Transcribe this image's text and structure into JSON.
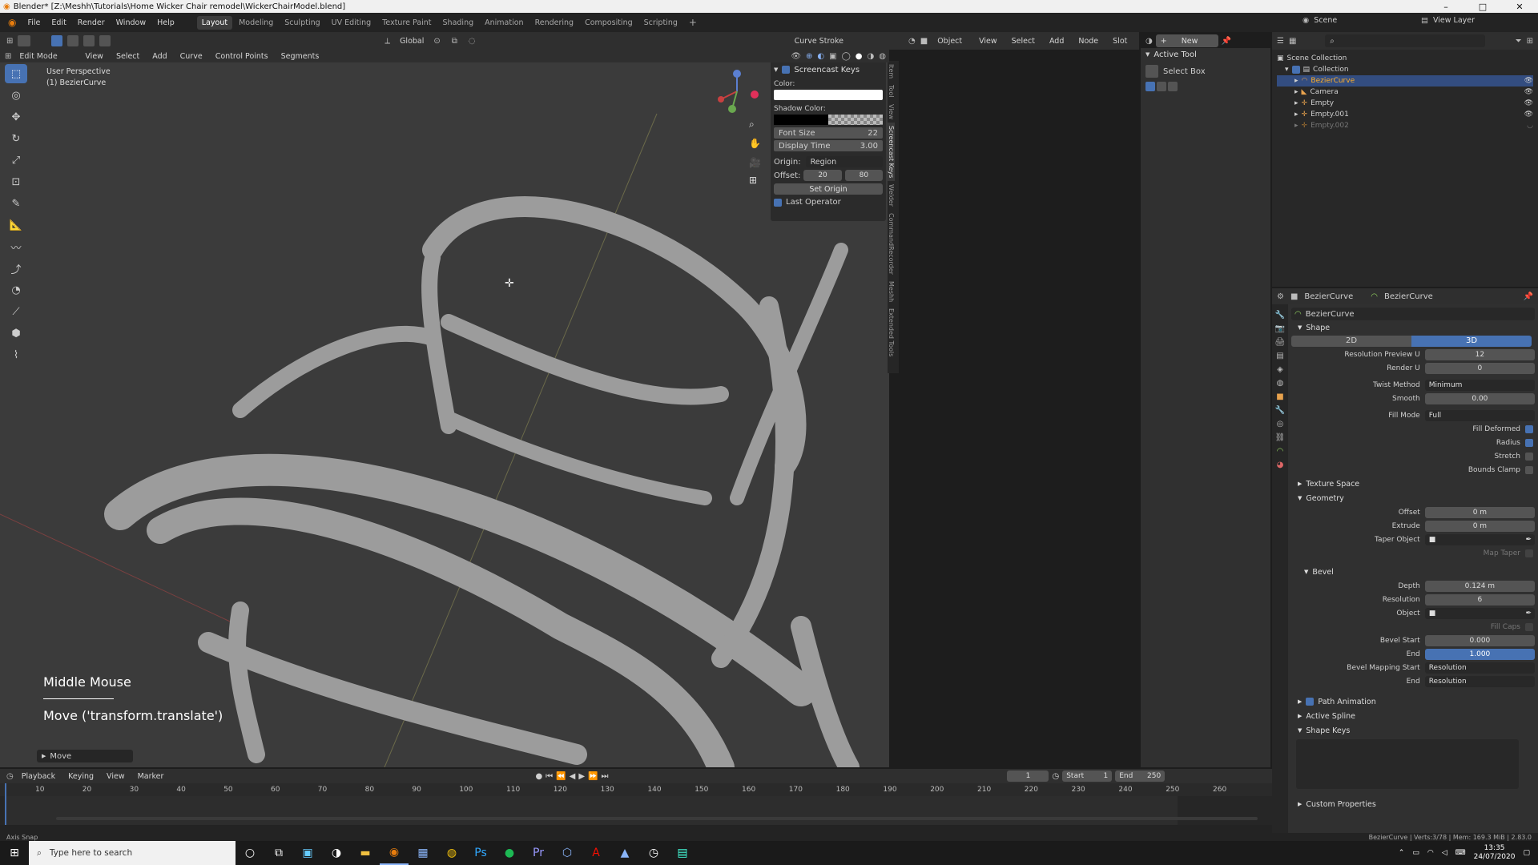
{
  "title_bar": {
    "text": "Blender* [Z:\\Meshh\\Tutorials\\Home Wicker Chair remodel\\WickerChairModel.blend]"
  },
  "menu": [
    "File",
    "Edit",
    "Render",
    "Window",
    "Help"
  ],
  "workspaces": [
    "Layout",
    "Modeling",
    "Sculpting",
    "UV Editing",
    "Texture Paint",
    "Shading",
    "Animation",
    "Rendering",
    "Compositing",
    "Scripting"
  ],
  "header": {
    "orientation": "Global",
    "curve_stroke": "Curve Stroke"
  },
  "vp_header": {
    "mode": "Edit Mode",
    "items": [
      "View",
      "Select",
      "Add",
      "Curve",
      "Control Points",
      "Segments"
    ]
  },
  "viewport": {
    "perspective": "User Perspective",
    "object": "(1) BezierCurve",
    "screencast_key": "Middle Mouse",
    "screencast_op": "Move ('transform.translate')",
    "last_op": "Move"
  },
  "npanel": {
    "title": "Screencast Keys",
    "color_label": "Color:",
    "shadow_label": "Shadow Color:",
    "font_size_label": "Font Size",
    "font_size": "22",
    "display_time_label": "Display Time",
    "display_time": "3.00",
    "origin_label": "Origin:",
    "origin": "Region",
    "offset_label": "Offset:",
    "offset_x": "20",
    "offset_y": "80",
    "set_origin": "Set Origin",
    "last_operator": "Last Operator"
  },
  "side_tabs": [
    "Item",
    "Tool",
    "View",
    "Screencast Keys",
    "Welder",
    "CommandRecorder",
    "Meshh",
    "Extended Tools"
  ],
  "node_header": {
    "object": "Object",
    "items": [
      "View",
      "Select",
      "Add",
      "Node"
    ],
    "slot": "Slot",
    "new": "New"
  },
  "active_tool": {
    "title": "Active Tool",
    "tool": "Select Box"
  },
  "outliner": {
    "scene": "Scene",
    "view_layer": "View Layer",
    "root": "Scene Collection",
    "collection": "Collection",
    "items": [
      "BezierCurve",
      "Camera",
      "Empty",
      "Empty.001",
      "Empty.002"
    ]
  },
  "props": {
    "obj1": "BezierCurve",
    "obj2": "BezierCurve",
    "data_name": "BezierCurve",
    "shape": "Shape",
    "btn_2d": "2D",
    "btn_3d": "3D",
    "rows1": [
      [
        "Resolution Preview U",
        "12"
      ],
      [
        "Render U",
        "0"
      ]
    ],
    "twist_label": "Twist Method",
    "twist": "Minimum",
    "smooth_label": "Smooth",
    "smooth": "0.00",
    "fill_label": "Fill Mode",
    "fill": "Full",
    "fill_deformed": "Fill Deformed",
    "radius": "Radius",
    "stretch": "Stretch",
    "bounds_clamp": "Bounds Clamp",
    "texture_space": "Texture Space",
    "geometry": "Geometry",
    "offset_label": "Offset",
    "offset": "0 m",
    "extrude_label": "Extrude",
    "extrude": "0 m",
    "taper_label": "Taper Object",
    "map_taper": "Map Taper",
    "bevel": "Bevel",
    "depth_label": "Depth",
    "depth": "0.124 m",
    "res_label": "Resolution",
    "res": "6",
    "object_label": "Object",
    "fill_caps": "Fill Caps",
    "bevel_start_label": "Bevel Start",
    "bevel_start": "0.000",
    "end_label": "End",
    "end": "1.000",
    "bevel_map_start_label": "Bevel Mapping Start",
    "bevel_map_start": "Resolution",
    "bevel_map_end_label": "End",
    "bevel_map_end": "Resolution",
    "path_animation": "Path Animation",
    "active_spline": "Active Spline",
    "shape_keys": "Shape Keys",
    "custom_props": "Custom Properties"
  },
  "timeline": {
    "menu": [
      "Playback",
      "Keying",
      "View",
      "Marker"
    ],
    "frame": "1",
    "start_label": "Start",
    "start": "1",
    "end_label": "End",
    "end": "250",
    "ticks": [
      "10",
      "20",
      "30",
      "40",
      "50",
      "60",
      "70",
      "80",
      "90",
      "100",
      "110",
      "120",
      "130",
      "140",
      "150",
      "160",
      "170",
      "180",
      "190",
      "200",
      "210",
      "220",
      "230",
      "240",
      "250",
      "260"
    ]
  },
  "status": {
    "left": "Axis Snap",
    "right": "BezierCurve | Verts:3/78 | Mem: 169.3 MiB | 2.83.0"
  },
  "taskbar": {
    "search": "Type here to search",
    "time": "13:35",
    "date": "24/07/2020"
  }
}
